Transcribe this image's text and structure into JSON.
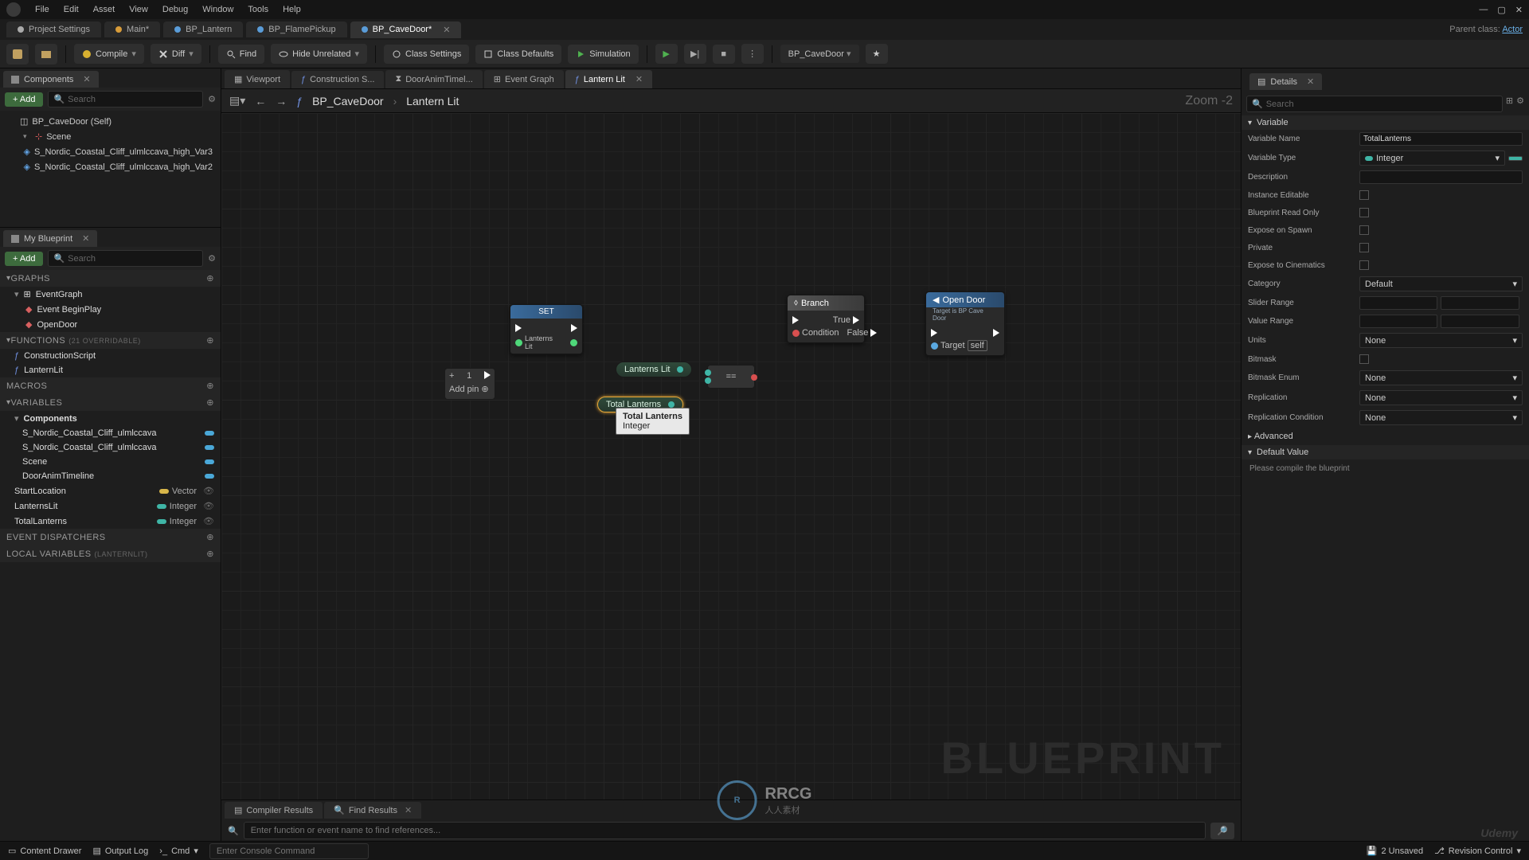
{
  "menu": {
    "items": [
      "File",
      "Edit",
      "Asset",
      "View",
      "Debug",
      "Window",
      "Tools",
      "Help"
    ]
  },
  "project_tabs": {
    "items": [
      {
        "label": "Project Settings",
        "icon": "#aaa"
      },
      {
        "label": "Main*",
        "icon": "#d89c3a"
      },
      {
        "label": "BP_Lantern",
        "icon": "#5a9cd8"
      },
      {
        "label": "BP_FlamePickup",
        "icon": "#5a9cd8"
      },
      {
        "label": "BP_CaveDoor*",
        "icon": "#5a9cd8",
        "active": true
      }
    ],
    "parent_class_label": "Parent class:",
    "parent_class": "Actor"
  },
  "toolbar": {
    "compile": "Compile",
    "diff": "Diff",
    "find": "Find",
    "hide_unrelated": "Hide Unrelated",
    "class_settings": "Class Settings",
    "class_defaults": "Class Defaults",
    "simulation": "Simulation",
    "debug_target": "BP_CaveDoor"
  },
  "components_panel": {
    "title": "Components",
    "add": "Add",
    "search_placeholder": "Search",
    "items": [
      {
        "label": "BP_CaveDoor (Self)",
        "indent": 0,
        "icon": "cube"
      },
      {
        "label": "Scene",
        "indent": 1,
        "icon": "axis"
      },
      {
        "label": "S_Nordic_Coastal_Cliff_ulmlccava_high_Var3",
        "indent": 2,
        "icon": "mesh"
      },
      {
        "label": "S_Nordic_Coastal_Cliff_ulmlccava_high_Var2",
        "indent": 2,
        "icon": "mesh"
      }
    ]
  },
  "myblueprint": {
    "title": "My Blueprint",
    "add": "Add",
    "search_placeholder": "Search",
    "sections": {
      "graphs": {
        "label": "GRAPHS",
        "items": [
          {
            "label": "EventGraph",
            "kind": "graph"
          },
          {
            "label": "Event BeginPlay",
            "kind": "event",
            "indent": 1
          },
          {
            "label": "OpenDoor",
            "kind": "event",
            "indent": 1
          }
        ]
      },
      "functions": {
        "label": "FUNCTIONS",
        "sub": "(21 OVERRIDABLE)",
        "items": [
          {
            "label": "ConstructionScript",
            "kind": "func"
          },
          {
            "label": "LanternLit",
            "kind": "func"
          }
        ]
      },
      "macros": {
        "label": "MACROS",
        "items": []
      },
      "variables": {
        "label": "VARIABLES",
        "items": [
          {
            "label": "Components",
            "kind": "folder"
          },
          {
            "label": "S_Nordic_Coastal_Cliff_ulmlccava",
            "kind": "var",
            "pill": "blue",
            "indent": 1
          },
          {
            "label": "S_Nordic_Coastal_Cliff_ulmlccava",
            "kind": "var",
            "pill": "blue",
            "indent": 1
          },
          {
            "label": "Scene",
            "kind": "var",
            "pill": "blue",
            "indent": 1
          },
          {
            "label": "DoorAnimTimeline",
            "kind": "var",
            "pill": "blue",
            "indent": 1
          },
          {
            "label": "StartLocation",
            "kind": "var",
            "type": "Vector",
            "pill": "gold"
          },
          {
            "label": "LanternsLit",
            "kind": "var",
            "type": "Integer",
            "pill": "teal"
          },
          {
            "label": "TotalLanterns",
            "kind": "var",
            "type": "Integer",
            "pill": "teal"
          }
        ]
      },
      "dispatchers": {
        "label": "EVENT DISPATCHERS",
        "items": []
      },
      "localvars": {
        "label": "LOCAL VARIABLES",
        "sub": "(LANTERNLIT)",
        "items": []
      }
    }
  },
  "center": {
    "tabs": [
      {
        "label": "Viewport",
        "active": false
      },
      {
        "label": "Construction S...",
        "active": false
      },
      {
        "label": "DoorAnimTimel...",
        "active": false
      },
      {
        "label": "Event Graph",
        "active": false
      },
      {
        "label": "Lantern Lit",
        "active": true
      }
    ],
    "breadcrumb": {
      "root": "BP_CaveDoor",
      "leaf": "Lantern Lit"
    },
    "zoom": "Zoom -2",
    "watermark": "BLUEPRINT",
    "nodes": {
      "set": {
        "title": "SET",
        "pin_label": "Lanterns Lit"
      },
      "branch": {
        "title": "Branch",
        "condition": "Condition",
        "true": "True",
        "false": "False"
      },
      "opendoor": {
        "title": "Open Door",
        "sub": "Target is BP Cave Door",
        "target": "Target",
        "self": "self"
      },
      "lanternslit": "Lanterns Lit",
      "totallanterns": "Total Lanterns",
      "addpin": "Add pin",
      "eq": "==",
      "sequence_pin": "1"
    },
    "tooltip": {
      "name": "Total Lanterns",
      "type": "Integer"
    },
    "bottom_tabs": {
      "compiler": "Compiler Results",
      "find": "Find Results",
      "find_placeholder": "Enter function or event name to find references..."
    }
  },
  "details": {
    "title": "Details",
    "search_placeholder": "Search",
    "section_variable": "Variable",
    "rows": {
      "name": {
        "label": "Variable Name",
        "value": "TotalLanterns"
      },
      "type": {
        "label": "Variable Type",
        "value": "Integer"
      },
      "desc": {
        "label": "Description",
        "value": ""
      },
      "instance": {
        "label": "Instance Editable"
      },
      "readonly": {
        "label": "Blueprint Read Only"
      },
      "spawn": {
        "label": "Expose on Spawn"
      },
      "private": {
        "label": "Private"
      },
      "cinematics": {
        "label": "Expose to Cinematics"
      },
      "category": {
        "label": "Category",
        "value": "Default"
      },
      "sliderrange": {
        "label": "Slider Range"
      },
      "valuerange": {
        "label": "Value Range"
      },
      "units": {
        "label": "Units",
        "value": "None"
      },
      "bitmask": {
        "label": "Bitmask"
      },
      "bitmaskenum": {
        "label": "Bitmask Enum",
        "value": "None"
      },
      "replication": {
        "label": "Replication",
        "value": "None"
      },
      "replcond": {
        "label": "Replication Condition",
        "value": "None"
      },
      "advanced": {
        "label": "Advanced"
      }
    },
    "section_default": "Default Value",
    "compile_msg": "Please compile the blueprint"
  },
  "statusbar": {
    "content_drawer": "Content Drawer",
    "output_log": "Output Log",
    "cmd_label": "Cmd",
    "cmd_placeholder": "Enter Console Command",
    "unsaved": "2 Unsaved",
    "revision": "Revision Control"
  },
  "logo": {
    "brand": "RRCG",
    "sub": "人人素材"
  },
  "udemy": "Udemy"
}
